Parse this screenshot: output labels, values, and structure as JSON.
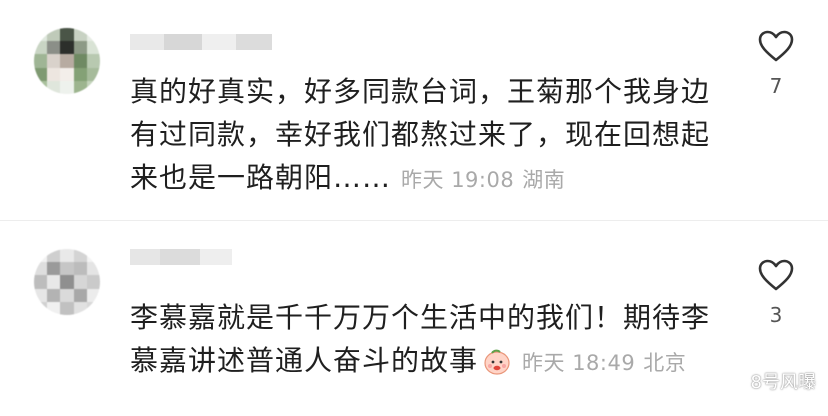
{
  "comments": [
    {
      "text": "真的好真实，好多同款台词，王菊那个我身边有过同款，幸好我们都熬过来了，现在回想起来也是一路朝阳……",
      "time": "昨天 19:08",
      "location": "湖南",
      "likes": "7",
      "avatar_icon": "blurred-avatar"
    },
    {
      "text": "李慕嘉就是千千万万个生活中的我们！期待李慕嘉讲述普通人奋斗的故事",
      "time": "昨天 18:49",
      "location": "北京",
      "likes": "3",
      "avatar_icon": "blurred-avatar",
      "emoji_icon": "peach-emoji"
    }
  ],
  "watermark": {
    "text": "8号风曝",
    "icon": "wechat-icon"
  },
  "colors": {
    "text": "#1f1f1f",
    "meta": "#a9a9a9",
    "divider": "#ededed"
  }
}
